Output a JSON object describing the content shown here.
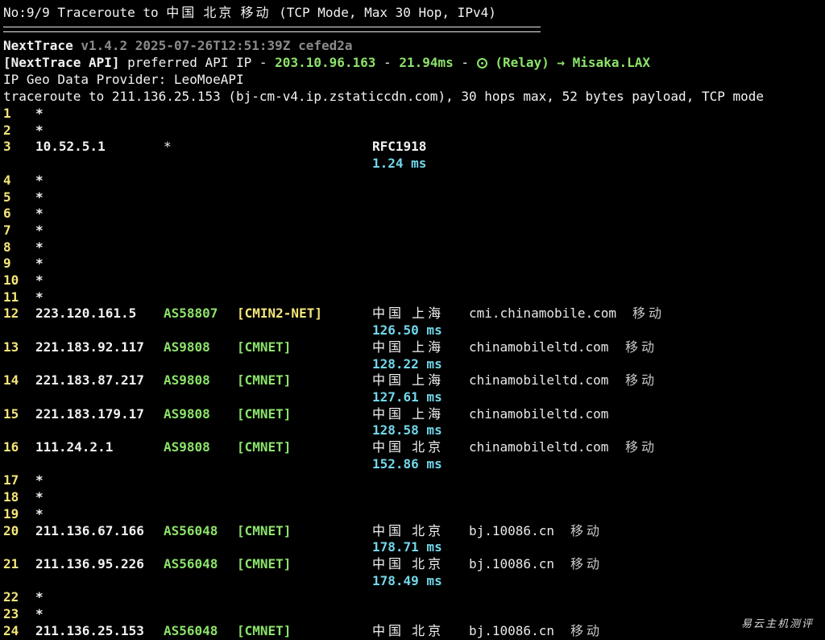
{
  "header": {
    "title_prefix": "No:9/9 Traceroute to",
    "title_dest": "中国 北京 移动",
    "title_suffix": "(TCP Mode, Max 30 Hop, IPv4)",
    "divider": "==========================================================="
  },
  "nexttrace": {
    "name": "NextTrace",
    "version": "v1.4.2 2025-07-26T12:51:39Z cefed2a"
  },
  "api": {
    "tag": "[NextTrace API]",
    "label": "preferred API IP -",
    "ip": "203.10.96.163",
    "sep1": "-",
    "latency": "21.94ms",
    "sep2": "-",
    "relay": "(Relay) → Misaka.LAX",
    "relay_icon": "relay-icon"
  },
  "geo_provider": "IP Geo Data Provider: LeoMoeAPI",
  "traceroute_line": "traceroute to 211.136.25.153 (bj-cm-v4.ip.zstaticcdn.com), 30 hops max, 52 bytes payload, TCP mode",
  "hops": [
    {
      "n": "1",
      "star": "*"
    },
    {
      "n": "2",
      "star": "*"
    },
    {
      "n": "3",
      "ip": "10.52.5.1",
      "asn": "*",
      "geo": "RFC1918",
      "rtt": "1.24 ms"
    },
    {
      "n": "4",
      "star": "*"
    },
    {
      "n": "5",
      "star": "*"
    },
    {
      "n": "6",
      "star": "*"
    },
    {
      "n": "7",
      "star": "*"
    },
    {
      "n": "8",
      "star": "*"
    },
    {
      "n": "9",
      "star": "*"
    },
    {
      "n": "10",
      "star": "*"
    },
    {
      "n": "11",
      "star": "*"
    },
    {
      "n": "12",
      "ip": "223.120.161.5",
      "asn": "AS58807",
      "net": "[CMIN2-NET]",
      "geo": "中国 上海",
      "host": "cmi.chinamobile.com",
      "isp": "移动",
      "rtt": "126.50 ms"
    },
    {
      "n": "13",
      "ip": "221.183.92.117",
      "asn": "AS9808",
      "net": "[CMNET]",
      "geo": "中国 上海",
      "host": "chinamobileltd.com",
      "isp": "移动",
      "rtt": "128.22 ms"
    },
    {
      "n": "14",
      "ip": "221.183.87.217",
      "asn": "AS9808",
      "net": "[CMNET]",
      "geo": "中国 上海",
      "host": "chinamobileltd.com",
      "isp": "移动",
      "rtt": "127.61 ms"
    },
    {
      "n": "15",
      "ip": "221.183.179.17",
      "asn": "AS9808",
      "net": "[CMNET]",
      "geo": "中国 上海",
      "host": "chinamobileltd.com",
      "rtt": "128.58 ms"
    },
    {
      "n": "16",
      "ip": "111.24.2.1",
      "asn": "AS9808",
      "net": "[CMNET]",
      "geo": "中国 北京",
      "host": "chinamobileltd.com",
      "isp": "移动",
      "rtt": "152.86 ms"
    },
    {
      "n": "17",
      "star": "*"
    },
    {
      "n": "18",
      "star": "*"
    },
    {
      "n": "19",
      "star": "*"
    },
    {
      "n": "20",
      "ip": "211.136.67.166",
      "asn": "AS56048",
      "net": "[CMNET]",
      "geo": "中国 北京",
      "host": "bj.10086.cn",
      "isp": "移动",
      "rtt": "178.71 ms"
    },
    {
      "n": "21",
      "ip": "211.136.95.226",
      "asn": "AS56048",
      "net": "[CMNET]",
      "geo": "中国 北京",
      "host": "bj.10086.cn",
      "isp": "移动",
      "rtt": "178.49 ms"
    },
    {
      "n": "22",
      "star": "*"
    },
    {
      "n": "23",
      "star": "*"
    },
    {
      "n": "24",
      "ip": "211.136.25.153",
      "asn": "AS56048",
      "net": "[CMNET]",
      "geo": "中国 北京",
      "host": "bj.10086.cn",
      "isp": "移动"
    }
  ],
  "watermark": "易云主机测评",
  "colors": {
    "background": "#000000",
    "text": "#f2f2f2",
    "hop_number": "#f5e67a",
    "asn": "#8ce36a",
    "net_tag_cmin2": "#f5e67a",
    "net_tag_cmnet": "#8ce36a",
    "rtt": "#72d7ea",
    "version_gray": "#8a8a8a"
  }
}
